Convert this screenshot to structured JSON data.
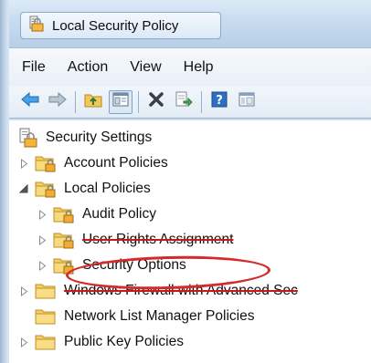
{
  "window": {
    "title": "Local Security Policy",
    "icon": "security-policy-icon"
  },
  "menu": {
    "items": [
      "File",
      "Action",
      "View",
      "Help"
    ]
  },
  "toolbar": {
    "buttons": [
      {
        "icon": "back-arrow-icon"
      },
      {
        "icon": "forward-arrow-icon"
      },
      {
        "icon": "up-folder-icon"
      },
      {
        "icon": "show-hide-tree-icon",
        "pressed": true
      },
      {
        "icon": "delete-icon"
      },
      {
        "icon": "export-list-icon"
      },
      {
        "icon": "help-icon"
      },
      {
        "icon": "properties-pane-icon"
      }
    ]
  },
  "tree": {
    "items": [
      {
        "label": "Security Settings",
        "level": 0,
        "expander": "none",
        "icon": "security-settings-icon"
      },
      {
        "label": "Account Policies",
        "level": 1,
        "expander": "collapsed",
        "icon": "policy-folder-icon"
      },
      {
        "label": "Local Policies",
        "level": 1,
        "expander": "expanded",
        "icon": "policy-folder-icon"
      },
      {
        "label": "Audit Policy",
        "level": 2,
        "expander": "collapsed",
        "icon": "policy-folder-icon"
      },
      {
        "label": "User Rights Assignment",
        "level": 2,
        "expander": "collapsed",
        "icon": "policy-folder-icon",
        "struck": true
      },
      {
        "label": "Security Options",
        "level": 2,
        "expander": "collapsed",
        "icon": "policy-folder-icon",
        "circled": true
      },
      {
        "label": "Windows Firewall with Advanced Sec",
        "level": 1,
        "expander": "collapsed",
        "icon": "folder-icon",
        "struck": true
      },
      {
        "label": "Network List Manager Policies",
        "level": 1,
        "expander": "none",
        "icon": "folder-icon"
      },
      {
        "label": "Public Key Policies",
        "level": 1,
        "expander": "collapsed",
        "icon": "folder-icon"
      }
    ]
  },
  "colors": {
    "highlight_circle": "#d42a2a",
    "window_frame": "#c5d9ee"
  }
}
